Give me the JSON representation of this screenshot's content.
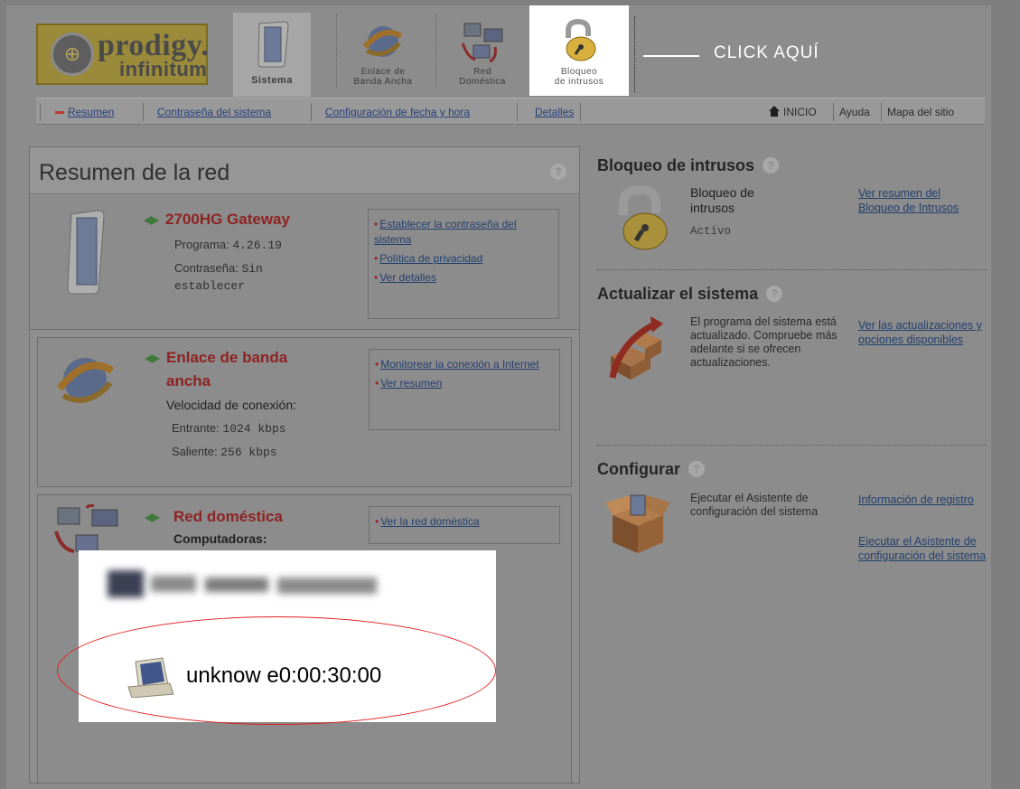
{
  "header": {
    "logo": {
      "line1": "prodigy.",
      "line2": "infinitum"
    },
    "tabs": [
      {
        "id": "sistema",
        "label": "Sistema"
      },
      {
        "id": "enlace",
        "label": "Enlace de\nBanda Ancha"
      },
      {
        "id": "red",
        "label": "Red\nDoméstica"
      },
      {
        "id": "bloqueo",
        "label": "Bloqueo\nde intrusos"
      }
    ],
    "callout": "CLICK AQUÍ"
  },
  "nav": {
    "links": [
      "Resumen",
      "Contraseña del sistema",
      "Configuración de fecha y hora",
      "Detalles"
    ],
    "right": {
      "home": "INICIO",
      "help": "Ayuda",
      "sitemap": "Mapa del sitio"
    }
  },
  "left": {
    "title": "Resumen de la red",
    "help": "?",
    "gateway": {
      "title": "2700HG Gateway",
      "program_label": "Programa:",
      "program_value": "4.26.19",
      "password_label": "Contraseña:",
      "password_value": "Sin",
      "password_value2": "establecer",
      "links": [
        "Establecer la contraseña del sistema",
        "Política de privacidad",
        "Ver detalles"
      ]
    },
    "broadband": {
      "title_line1": "Enlace de banda",
      "title_line2": "ancha",
      "speed_label": "Velocidad de conexión:",
      "in_label": "Entrante:",
      "in_value": "1024 kbps",
      "out_label": "Saliente:",
      "out_value": "256 kbps",
      "links": [
        "Monitorear la conexión a Internet",
        "Ver resumen"
      ]
    },
    "home_network": {
      "title": "Red doméstica",
      "computers_label": "Computadoras:",
      "links": [
        "Ver la red doméstica"
      ]
    }
  },
  "right": {
    "intrusion": {
      "title": "Bloqueo de intrusos",
      "label_line1": "Bloqueo de",
      "label_line2": "intrusos",
      "status": "Activo",
      "link": "Ver resumen del Bloqueo de Intrusos"
    },
    "update": {
      "title": "Actualizar el sistema",
      "text": "El programa del sistema está actualizado. Compruebe más adelante si se ofrecen actualizaciones.",
      "link": "Ver las actualizaciones y opciones disponibles"
    },
    "configure": {
      "title": "Configurar",
      "text": "Ejecutar el Asistente de configuración del sistema",
      "links": [
        "Información de registro",
        "Ejecutar el Asistente de configuración del sistema"
      ]
    }
  },
  "overlay": {
    "device": "unknow e0:00:30:00"
  },
  "colors": {
    "accent_red": "#8f2323",
    "link_blue": "#23406f",
    "annotation_red": "#e02020"
  }
}
